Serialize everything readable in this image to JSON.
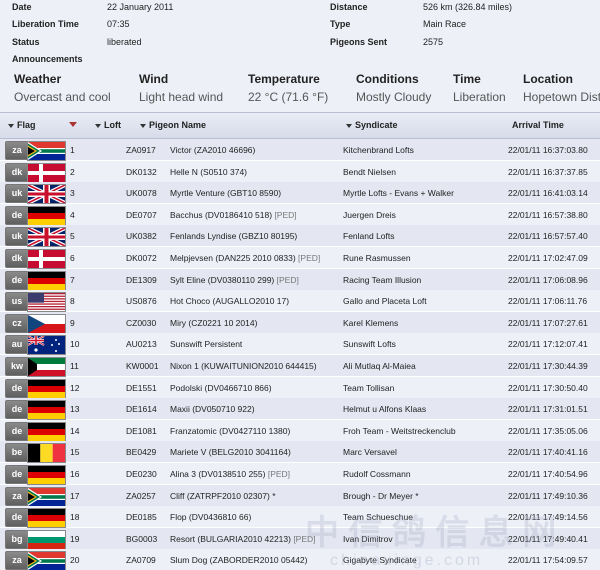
{
  "race": {
    "date_label": "Date",
    "date_value": "22 January 2011",
    "liberation_time_label": "Liberation Time",
    "liberation_time_value": "07:35",
    "status_label": "Status",
    "status_value": "liberated",
    "distance_label": "Distance",
    "distance_value": "526 km (326.84 miles)",
    "type_label": "Type",
    "type_value": "Main Race",
    "pigeons_sent_label": "Pigeons Sent",
    "pigeons_sent_value": "2575",
    "announcements_label": "Announcements"
  },
  "weather": {
    "headers": [
      "Weather",
      "Wind",
      "Temperature",
      "Conditions",
      "Time",
      "Location"
    ],
    "values": [
      "Overcast and cool",
      "Light head wind",
      "22 °C (71.6 °F)",
      "Mostly Cloudy",
      "Liberation",
      "Hopetown Dist"
    ]
  },
  "table": {
    "headers": {
      "flag": "Flag",
      "loft": "Loft",
      "pigeon": "Pigeon Name",
      "syndicate": "Syndicate",
      "arrival": "Arrival Time"
    },
    "rows": [
      {
        "code": "za",
        "flag": "za",
        "pos": "1",
        "loft": "ZA0917",
        "pigeon": "Victor (ZA2010 46696)",
        "ped": "",
        "syndicate": "Kitchenbrand Lofts",
        "arrival": "22/01/11 16:37:03.80"
      },
      {
        "code": "dk",
        "flag": "dk",
        "pos": "2",
        "loft": "DK0132",
        "pigeon": "Helle N (S0510 374)",
        "ped": "",
        "syndicate": "Bendt Nielsen",
        "arrival": "22/01/11 16:37:37.85"
      },
      {
        "code": "uk",
        "flag": "uk",
        "pos": "3",
        "loft": "UK0078",
        "pigeon": "Myrtle Venture (GBT10 8590)",
        "ped": "",
        "syndicate": "Myrtle Lofts - Evans + Walker",
        "arrival": "22/01/11 16:41:03.14"
      },
      {
        "code": "de",
        "flag": "de",
        "pos": "4",
        "loft": "DE0707",
        "pigeon": "Bacchus (DV0186410 518)",
        "ped": "[PED]",
        "syndicate": "Juergen Dreis",
        "arrival": "22/01/11 16:57:38.80"
      },
      {
        "code": "uk",
        "flag": "uk",
        "pos": "5",
        "loft": "UK0382",
        "pigeon": "Fenlands Lyndise (GBZ10 80195)",
        "ped": "",
        "syndicate": "Fenland Lofts",
        "arrival": "22/01/11 16:57:57.40"
      },
      {
        "code": "dk",
        "flag": "dk",
        "pos": "6",
        "loft": "DK0072",
        "pigeon": "Melpjevsen (DAN225 2010 0833)",
        "ped": "[PED]",
        "syndicate": "Rune Rasmussen",
        "arrival": "22/01/11 17:02:47.09"
      },
      {
        "code": "de",
        "flag": "de",
        "pos": "7",
        "loft": "DE1309",
        "pigeon": "Sylt Eline (DV0380110 299)",
        "ped": "[PED]",
        "syndicate": "Racing Team Illusion",
        "arrival": "22/01/11 17:06:08.96"
      },
      {
        "code": "us",
        "flag": "us",
        "pos": "8",
        "loft": "US0876",
        "pigeon": "Hot Choco (AUGALLO2010 17)",
        "ped": "",
        "syndicate": "Gallo and Placeta Loft",
        "arrival": "22/01/11 17:06:11.76"
      },
      {
        "code": "cz",
        "flag": "cz",
        "pos": "9",
        "loft": "CZ0030",
        "pigeon": "Miry (CZ0221 10 2014)",
        "ped": "",
        "syndicate": "Karel Klemens",
        "arrival": "22/01/11 17:07:27.61"
      },
      {
        "code": "au",
        "flag": "au",
        "pos": "10",
        "loft": "AU0213",
        "pigeon": "Sunswift Persistent",
        "ped": "",
        "syndicate": "Sunswift Lofts",
        "arrival": "22/01/11 17:12:07.41"
      },
      {
        "code": "kw",
        "flag": "kw",
        "pos": "11",
        "loft": "KW0001",
        "pigeon": "Nixon 1 (KUWAITUNION2010 644415)",
        "ped": "",
        "syndicate": "Ali Mutlaq Al-Maiea",
        "arrival": "22/01/11 17:30:44.39"
      },
      {
        "code": "de",
        "flag": "de",
        "pos": "12",
        "loft": "DE1551",
        "pigeon": "Podolski (DV0466710 866)",
        "ped": "",
        "syndicate": "Team Tollisan",
        "arrival": "22/01/11 17:30:50.40"
      },
      {
        "code": "de",
        "flag": "de",
        "pos": "13",
        "loft": "DE1614",
        "pigeon": "Maxii (DV050710 922)",
        "ped": "",
        "syndicate": "Helmut u Alfons Klaas",
        "arrival": "22/01/11 17:31:01.51"
      },
      {
        "code": "de",
        "flag": "de",
        "pos": "14",
        "loft": "DE1081",
        "pigeon": "Franzatomic (DV0427110 1380)",
        "ped": "",
        "syndicate": "Froh Team - Weitstreckenclub",
        "arrival": "22/01/11 17:35:05.06"
      },
      {
        "code": "be",
        "flag": "be",
        "pos": "15",
        "loft": "BE0429",
        "pigeon": "Mariete V (BELG2010 3041164)",
        "ped": "",
        "syndicate": "Marc Versavel",
        "arrival": "22/01/11 17:40:41.16"
      },
      {
        "code": "de",
        "flag": "de",
        "pos": "16",
        "loft": "DE0230",
        "pigeon": "Alina 3 (DV0138510 255)",
        "ped": "[PED]",
        "syndicate": "Rudolf Cossmann",
        "arrival": "22/01/11 17:40:54.96"
      },
      {
        "code": "za",
        "flag": "za",
        "pos": "17",
        "loft": "ZA0257",
        "pigeon": "Cliff (ZATRPF2010 02307) *",
        "ped": "",
        "syndicate": "Brough - Dr Meyer *",
        "arrival": "22/01/11 17:49:10.36"
      },
      {
        "code": "de",
        "flag": "de",
        "pos": "18",
        "loft": "DE0185",
        "pigeon": "Flop (DV0436810 66)",
        "ped": "",
        "syndicate": "Team Schueschue",
        "arrival": "22/01/11 17:49:14.56"
      },
      {
        "code": "bg",
        "flag": "bg",
        "pos": "19",
        "loft": "BG0003",
        "pigeon": "Resort (BULGARIA2010 42213)",
        "ped": "[PED]",
        "syndicate": "Ivan Dimitrov",
        "arrival": "22/01/11 17:49:40.41"
      },
      {
        "code": "za",
        "flag": "za",
        "pos": "20",
        "loft": "ZA0709",
        "pigeon": "Slum Dog (ZABORDER2010 05442)",
        "ped": "",
        "syndicate": "Gigabyte Syndicate",
        "arrival": "22/01/11 17:54:09.57"
      }
    ]
  },
  "watermark": {
    "text": "中 信 鸽 信 息 网",
    "url": "chinaxinge.com"
  }
}
